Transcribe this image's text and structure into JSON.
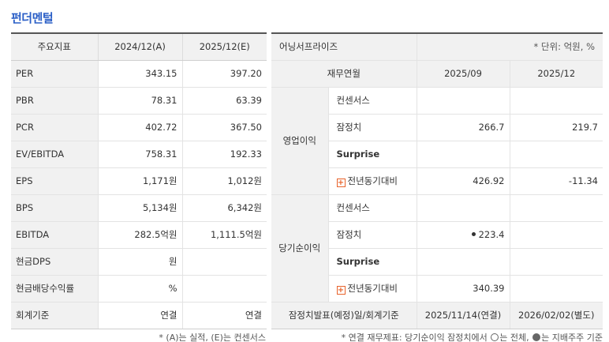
{
  "title": "펀더멘털",
  "fundamental": {
    "headers": [
      "주요지표",
      "2024/12(A)",
      "2025/12(E)"
    ],
    "rows": [
      {
        "label": "PER",
        "a": "343.15",
        "e": "397.20"
      },
      {
        "label": "PBR",
        "a": "78.31",
        "e": "63.39"
      },
      {
        "label": "PCR",
        "a": "402.72",
        "e": "367.50"
      },
      {
        "label": "EV/EBITDA",
        "a": "758.31",
        "e": "192.33"
      },
      {
        "label": "EPS",
        "a": "1,171원",
        "e": "1,012원"
      },
      {
        "label": "BPS",
        "a": "5,134원",
        "e": "6,342원"
      },
      {
        "label": "EBITDA",
        "a": "282.5억원",
        "e": "1,111.5억원"
      },
      {
        "label": "현금DPS",
        "a": "원",
        "e": ""
      },
      {
        "label": "현금배당수익률",
        "a": "%",
        "e": ""
      },
      {
        "label": "회계기준",
        "a": "연결",
        "e": "연결"
      }
    ],
    "note": "* (A)는 실적, (E)는 컨센서스"
  },
  "earnings": {
    "title": "어닝서프라이즈",
    "unit": "* 단위: 억원, %",
    "period_header": "재무연월",
    "periods": [
      "2025/09",
      "2025/12"
    ],
    "groups": [
      {
        "name": "영업이익",
        "rows": [
          {
            "label": "컨센서스",
            "v1": "",
            "v2": ""
          },
          {
            "label": "잠정치",
            "v1": "266.7",
            "v2": "219.7"
          },
          {
            "label": "Surprise",
            "v1": "",
            "v2": ""
          },
          {
            "label": "전년동기대비",
            "v1": "426.92",
            "v2": "-11.34"
          }
        ]
      },
      {
        "name": "당기순이익",
        "rows": [
          {
            "label": "컨센서스",
            "v1": "",
            "v2": ""
          },
          {
            "label": "잠정치",
            "v1": "223.4",
            "v2": ""
          },
          {
            "label": "Surprise",
            "v1": "",
            "v2": ""
          },
          {
            "label": "전년동기대비",
            "v1": "340.39",
            "v2": ""
          }
        ]
      }
    ],
    "footer": {
      "label": "잠정치발표(예정)일/회계기준",
      "v1": "2025/11/14(연결)",
      "v2": "2026/02/02(별도)"
    },
    "note": {
      "part1": "* 연결 재무제표: 당기순이익 잠정치에서",
      "part2": "는 전체,",
      "part3": "는 지배주주 기준"
    }
  }
}
